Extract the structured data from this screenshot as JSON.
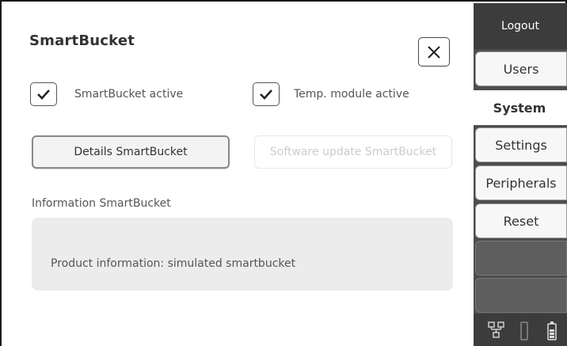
{
  "page": {
    "title": "SmartBucket",
    "close_label": "×",
    "checkboxes": [
      {
        "label": "SmartBucket active",
        "checked": true
      },
      {
        "label": "Temp. module active",
        "checked": true
      }
    ],
    "buttons": {
      "details": "Details SmartBucket",
      "software_update": "Software update SmartBucket"
    },
    "info": {
      "heading": "Information SmartBucket",
      "text": "Product information: simulated smartbucket"
    }
  },
  "sidebar": {
    "logout": "Logout",
    "tabs": [
      {
        "label": "Users",
        "active": false
      },
      {
        "label": "System",
        "active": true
      },
      {
        "label": "Settings",
        "active": false
      },
      {
        "label": "Peripherals",
        "active": false
      },
      {
        "label": "Reset",
        "active": false
      }
    ],
    "status_icons": [
      "network-icon",
      "thermometer-icon",
      "battery-icon"
    ]
  },
  "colors": {
    "sidebar_bg": "#4d4d4d",
    "info_box_bg": "#ececec",
    "disabled_text": "#cccccc"
  }
}
